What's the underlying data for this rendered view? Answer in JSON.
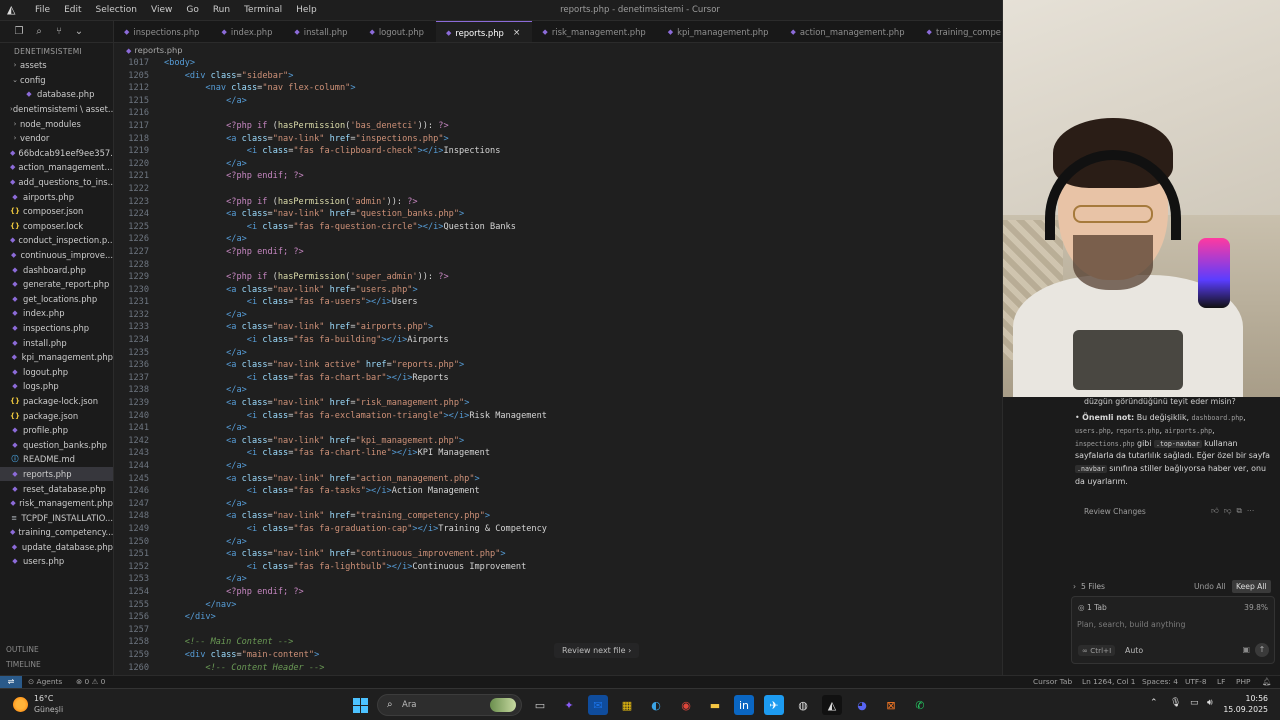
{
  "window": {
    "title": "reports.php - denetimsistemi - Cursor",
    "menu": [
      "File",
      "Edit",
      "Selection",
      "View",
      "Go",
      "Run",
      "Terminal",
      "Help"
    ]
  },
  "sidebar": {
    "project": "DENETIMSISTEMI",
    "items": [
      {
        "label": "assets",
        "type": "folder",
        "chev": "›"
      },
      {
        "label": "config",
        "type": "folder",
        "chev": "⌄"
      },
      {
        "label": "database.php",
        "type": "php",
        "indent": 1
      },
      {
        "label": "denetimsistemi \\ asset...",
        "type": "folder",
        "chev": "›"
      },
      {
        "label": "node_modules",
        "type": "folder",
        "chev": "›"
      },
      {
        "label": "vendor",
        "type": "folder",
        "chev": "›"
      },
      {
        "label": "66bdcab91eef9ee357...",
        "type": "php"
      },
      {
        "label": "action_management....",
        "type": "php"
      },
      {
        "label": "add_questions_to_ins...",
        "type": "php"
      },
      {
        "label": "airports.php",
        "type": "php"
      },
      {
        "label": "composer.json",
        "type": "json"
      },
      {
        "label": "composer.lock",
        "type": "json"
      },
      {
        "label": "conduct_inspection.p...",
        "type": "php"
      },
      {
        "label": "continuous_improve...",
        "type": "php"
      },
      {
        "label": "dashboard.php",
        "type": "php"
      },
      {
        "label": "generate_report.php",
        "type": "php"
      },
      {
        "label": "get_locations.php",
        "type": "php"
      },
      {
        "label": "index.php",
        "type": "php"
      },
      {
        "label": "inspections.php",
        "type": "php"
      },
      {
        "label": "install.php",
        "type": "php"
      },
      {
        "label": "kpi_management.php",
        "type": "php"
      },
      {
        "label": "logout.php",
        "type": "php"
      },
      {
        "label": "logs.php",
        "type": "php"
      },
      {
        "label": "package-lock.json",
        "type": "json"
      },
      {
        "label": "package.json",
        "type": "json"
      },
      {
        "label": "profile.php",
        "type": "php"
      },
      {
        "label": "question_banks.php",
        "type": "php"
      },
      {
        "label": "README.md",
        "type": "md"
      },
      {
        "label": "reports.php",
        "type": "php",
        "active": true
      },
      {
        "label": "reset_database.php",
        "type": "php"
      },
      {
        "label": "risk_management.php",
        "type": "php"
      },
      {
        "label": "TCPDF_INSTALLATIO...",
        "type": "txt"
      },
      {
        "label": "training_competency...",
        "type": "php"
      },
      {
        "label": "update_database.php",
        "type": "php"
      },
      {
        "label": "users.php",
        "type": "php"
      }
    ],
    "outline": "OUTLINE",
    "timeline": "TIMELINE"
  },
  "tabs": [
    {
      "label": "inspections.php"
    },
    {
      "label": "index.php"
    },
    {
      "label": "install.php"
    },
    {
      "label": "logout.php"
    },
    {
      "label": "reports.php",
      "active": true
    },
    {
      "label": "risk_management.php"
    },
    {
      "label": "kpi_management.php"
    },
    {
      "label": "action_management.php"
    },
    {
      "label": "training_compe"
    }
  ],
  "breadcrumb": "reports.php",
  "code_lines": [
    {
      "n": "1017",
      "html": "<span class=\"tag\">&lt;body&gt;</span>"
    },
    {
      "n": "1205",
      "html": "    <span class=\"tag\">&lt;div</span> <span class=\"attr\">class</span>=<span class=\"str\">\"sidebar\"</span><span class=\"tag\">&gt;</span>"
    },
    {
      "n": "1212",
      "html": "        <span class=\"tag\">&lt;nav</span> <span class=\"attr\">class</span>=<span class=\"str\">\"nav flex-column\"</span><span class=\"tag\">&gt;</span>"
    },
    {
      "n": "1215",
      "html": "            <span class=\"tag\">&lt;/a&gt;</span>"
    },
    {
      "n": "1216",
      "html": ""
    },
    {
      "n": "1217",
      "html": "            <span class=\"kw\">&lt;?php if</span> (<span class=\"fn\">hasPermission</span>(<span class=\"str\">'bas_denetci'</span>)): <span class=\"kw\">?&gt;</span>"
    },
    {
      "n": "1218",
      "html": "            <span class=\"tag\">&lt;a</span> <span class=\"attr\">class</span>=<span class=\"str\">\"nav-link\"</span> <span class=\"attr\">href</span>=<span class=\"str\">\"inspections.php\"</span><span class=\"tag\">&gt;</span>"
    },
    {
      "n": "1219",
      "html": "                <span class=\"tag\">&lt;i</span> <span class=\"attr\">class</span>=<span class=\"str\">\"fas fa-clipboard-check\"</span><span class=\"tag\">&gt;&lt;/i&gt;</span>Inspections"
    },
    {
      "n": "1220",
      "html": "            <span class=\"tag\">&lt;/a&gt;</span>"
    },
    {
      "n": "1221",
      "html": "            <span class=\"kw\">&lt;?php endif; ?&gt;</span>"
    },
    {
      "n": "1222",
      "html": ""
    },
    {
      "n": "1223",
      "html": "            <span class=\"kw\">&lt;?php if</span> (<span class=\"fn\">hasPermission</span>(<span class=\"str\">'admin'</span>)): <span class=\"kw\">?&gt;</span>"
    },
    {
      "n": "1224",
      "html": "            <span class=\"tag\">&lt;a</span> <span class=\"attr\">class</span>=<span class=\"str\">\"nav-link\"</span> <span class=\"attr\">href</span>=<span class=\"str\">\"question_banks.php\"</span><span class=\"tag\">&gt;</span>"
    },
    {
      "n": "1225",
      "html": "                <span class=\"tag\">&lt;i</span> <span class=\"attr\">class</span>=<span class=\"str\">\"fas fa-question-circle\"</span><span class=\"tag\">&gt;&lt;/i&gt;</span>Question Banks"
    },
    {
      "n": "1226",
      "html": "            <span class=\"tag\">&lt;/a&gt;</span>"
    },
    {
      "n": "1227",
      "html": "            <span class=\"kw\">&lt;?php endif; ?&gt;</span>"
    },
    {
      "n": "1228",
      "html": ""
    },
    {
      "n": "1229",
      "html": "            <span class=\"kw\">&lt;?php if</span> (<span class=\"fn\">hasPermission</span>(<span class=\"str\">'super_admin'</span>)): <span class=\"kw\">?&gt;</span>"
    },
    {
      "n": "1230",
      "html": "            <span class=\"tag\">&lt;a</span> <span class=\"attr\">class</span>=<span class=\"str\">\"nav-link\"</span> <span class=\"attr\">href</span>=<span class=\"str\">\"users.php\"</span><span class=\"tag\">&gt;</span>"
    },
    {
      "n": "1231",
      "html": "                <span class=\"tag\">&lt;i</span> <span class=\"attr\">class</span>=<span class=\"str\">\"fas fa-users\"</span><span class=\"tag\">&gt;&lt;/i&gt;</span>Users"
    },
    {
      "n": "1232",
      "html": "            <span class=\"tag\">&lt;/a&gt;</span>"
    },
    {
      "n": "1233",
      "html": "            <span class=\"tag\">&lt;a</span> <span class=\"attr\">class</span>=<span class=\"str\">\"nav-link\"</span> <span class=\"attr\">href</span>=<span class=\"str\">\"airports.php\"</span><span class=\"tag\">&gt;</span>"
    },
    {
      "n": "1234",
      "html": "                <span class=\"tag\">&lt;i</span> <span class=\"attr\">class</span>=<span class=\"str\">\"fas fa-building\"</span><span class=\"tag\">&gt;&lt;/i&gt;</span>Airports"
    },
    {
      "n": "1235",
      "html": "            <span class=\"tag\">&lt;/a&gt;</span>"
    },
    {
      "n": "1236",
      "html": "            <span class=\"tag\">&lt;a</span> <span class=\"attr\">class</span>=<span class=\"str\">\"nav-link active\"</span> <span class=\"attr\">href</span>=<span class=\"str\">\"reports.php\"</span><span class=\"tag\">&gt;</span>"
    },
    {
      "n": "1237",
      "html": "                <span class=\"tag\">&lt;i</span> <span class=\"attr\">class</span>=<span class=\"str\">\"fas fa-chart-bar\"</span><span class=\"tag\">&gt;&lt;/i&gt;</span>Reports"
    },
    {
      "n": "1238",
      "html": "            <span class=\"tag\">&lt;/a&gt;</span>"
    },
    {
      "n": "1239",
      "html": "            <span class=\"tag\">&lt;a</span> <span class=\"attr\">class</span>=<span class=\"str\">\"nav-link\"</span> <span class=\"attr\">href</span>=<span class=\"str\">\"risk_management.php\"</span><span class=\"tag\">&gt;</span>"
    },
    {
      "n": "1240",
      "html": "                <span class=\"tag\">&lt;i</span> <span class=\"attr\">class</span>=<span class=\"str\">\"fas fa-exclamation-triangle\"</span><span class=\"tag\">&gt;&lt;/i&gt;</span>Risk Management"
    },
    {
      "n": "1241",
      "html": "            <span class=\"tag\">&lt;/a&gt;</span>"
    },
    {
      "n": "1242",
      "html": "            <span class=\"tag\">&lt;a</span> <span class=\"attr\">class</span>=<span class=\"str\">\"nav-link\"</span> <span class=\"attr\">href</span>=<span class=\"str\">\"kpi_management.php\"</span><span class=\"tag\">&gt;</span>"
    },
    {
      "n": "1243",
      "html": "                <span class=\"tag\">&lt;i</span> <span class=\"attr\">class</span>=<span class=\"str\">\"fas fa-chart-line\"</span><span class=\"tag\">&gt;&lt;/i&gt;</span>KPI Management"
    },
    {
      "n": "1244",
      "html": "            <span class=\"tag\">&lt;/a&gt;</span>"
    },
    {
      "n": "1245",
      "html": "            <span class=\"tag\">&lt;a</span> <span class=\"attr\">class</span>=<span class=\"str\">\"nav-link\"</span> <span class=\"attr\">href</span>=<span class=\"str\">\"action_management.php\"</span><span class=\"tag\">&gt;</span>"
    },
    {
      "n": "1246",
      "html": "                <span class=\"tag\">&lt;i</span> <span class=\"attr\">class</span>=<span class=\"str\">\"fas fa-tasks\"</span><span class=\"tag\">&gt;&lt;/i&gt;</span>Action Management"
    },
    {
      "n": "1247",
      "html": "            <span class=\"tag\">&lt;/a&gt;</span>"
    },
    {
      "n": "1248",
      "html": "            <span class=\"tag\">&lt;a</span> <span class=\"attr\">class</span>=<span class=\"str\">\"nav-link\"</span> <span class=\"attr\">href</span>=<span class=\"str\">\"training_competency.php\"</span><span class=\"tag\">&gt;</span>"
    },
    {
      "n": "1249",
      "html": "                <span class=\"tag\">&lt;i</span> <span class=\"attr\">class</span>=<span class=\"str\">\"fas fa-graduation-cap\"</span><span class=\"tag\">&gt;&lt;/i&gt;</span>Training &amp; Competency"
    },
    {
      "n": "1250",
      "html": "            <span class=\"tag\">&lt;/a&gt;</span>"
    },
    {
      "n": "1251",
      "html": "            <span class=\"tag\">&lt;a</span> <span class=\"attr\">class</span>=<span class=\"str\">\"nav-link\"</span> <span class=\"attr\">href</span>=<span class=\"str\">\"continuous_improvement.php\"</span><span class=\"tag\">&gt;</span>"
    },
    {
      "n": "1252",
      "html": "                <span class=\"tag\">&lt;i</span> <span class=\"attr\">class</span>=<span class=\"str\">\"fas fa-lightbulb\"</span><span class=\"tag\">&gt;&lt;/i&gt;</span>Continuous Improvement"
    },
    {
      "n": "1253",
      "html": "            <span class=\"tag\">&lt;/a&gt;</span>"
    },
    {
      "n": "1254",
      "html": "            <span class=\"kw\">&lt;?php endif; ?&gt;</span>"
    },
    {
      "n": "1255",
      "html": "        <span class=\"tag\">&lt;/nav&gt;</span>"
    },
    {
      "n": "1256",
      "html": "    <span class=\"tag\">&lt;/div&gt;</span>"
    },
    {
      "n": "1257",
      "html": ""
    },
    {
      "n": "1258",
      "html": "    <span class=\"cmt\">&lt;!-- Main Content --&gt;</span>"
    },
    {
      "n": "1259",
      "html": "    <span class=\"tag\">&lt;div</span> <span class=\"attr\">class</span>=<span class=\"str\">\"main-content\"</span><span class=\"tag\">&gt;</span>"
    },
    {
      "n": "1260",
      "html": "        <span class=\"cmt\">&lt;!-- Content Header --&gt;</span>"
    }
  ],
  "editor": {
    "review_next": "Review next file ›"
  },
  "chat": {
    "cut_line": "düzgün göründüğünü teyit eder misin?",
    "note_html": "• <b>Önemli not:</b> Bu değişiklik, <code>dashboard.php</code>, <code>users.php</code>, <code>reports.php</code>, <code>airports.php</code>, <code>inspections.php</code> gibi <code class=\"hl\">.top-navbar</code> kullanan sayfalarla da tutarlılık sağladı. Eğer özel bir sayfa <code class=\"hl\">.navbar</code> sınıfına stiller bağlıyorsa haber ver, onu da uyarlarım.",
    "review_changes": "Review Changes",
    "files": "5 Files",
    "undo_all": "Undo All",
    "keep_all": "Keep All",
    "tab_chip": "1 Tab",
    "percent": "39.8%",
    "placeholder": "Plan, search, build anything",
    "mode": "∞ Ctrl+I",
    "auto": "Auto"
  },
  "statusbar": {
    "agents": "Agents",
    "problems": "⊗ 0 ⚠ 0",
    "cursor_tab": "Cursor Tab",
    "position": "Ln 1264, Col 1",
    "spaces": "Spaces: 4",
    "encoding": "UTF-8",
    "eol": "LF",
    "lang": "PHP"
  },
  "taskbar": {
    "temp": "16°C",
    "weather": "Güneşli",
    "search_placeholder": "Ara",
    "time": "10:56",
    "date": "15.09.2025"
  }
}
